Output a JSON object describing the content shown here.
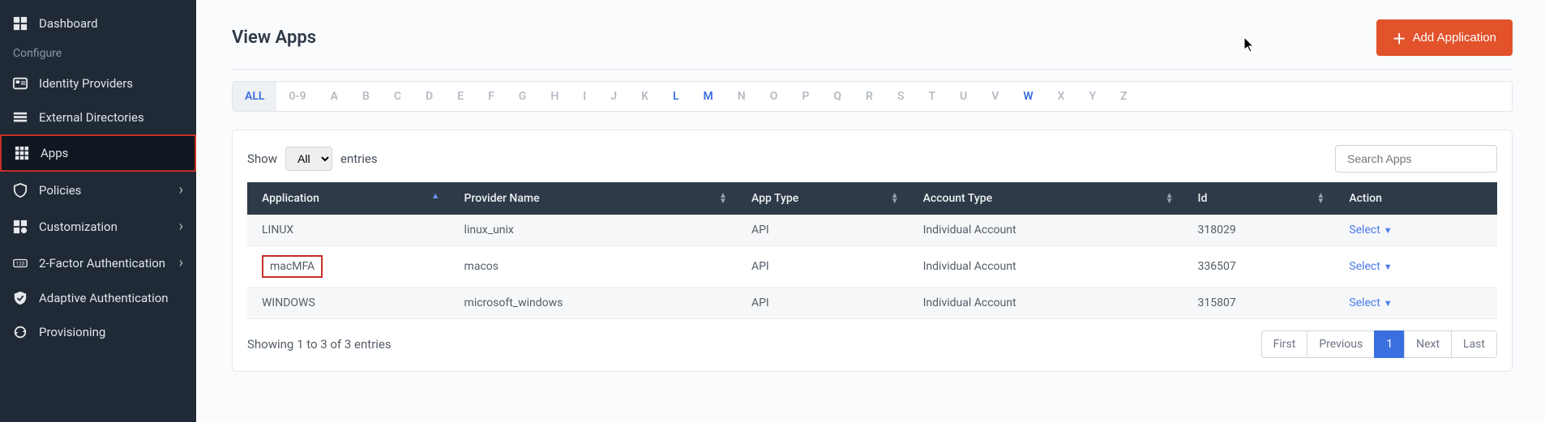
{
  "sidebar": {
    "dashboard": "Dashboard",
    "configure_label": "Configure",
    "items": [
      {
        "label": "Identity Providers",
        "icon": "id"
      },
      {
        "label": "External Directories",
        "icon": "dir"
      },
      {
        "label": "Apps",
        "icon": "grid",
        "active": true
      },
      {
        "label": "Policies",
        "icon": "shield",
        "chev": true
      },
      {
        "label": "Customization",
        "icon": "custom",
        "chev": true
      },
      {
        "label": "2-Factor Authentication",
        "icon": "twofa",
        "chev": true
      },
      {
        "label": "Adaptive Authentication",
        "icon": "adapt"
      },
      {
        "label": "Provisioning",
        "icon": "prov"
      }
    ]
  },
  "header": {
    "title": "View Apps",
    "add_button": "Add Application"
  },
  "alpha": {
    "all": "ALL",
    "items": [
      "0-9",
      "A",
      "B",
      "C",
      "D",
      "E",
      "F",
      "G",
      "H",
      "I",
      "J",
      "K",
      "L",
      "M",
      "N",
      "O",
      "P",
      "Q",
      "R",
      "S",
      "T",
      "U",
      "V",
      "W",
      "X",
      "Y",
      "Z"
    ],
    "highlighted": [
      "L",
      "M",
      "W"
    ]
  },
  "toolbar": {
    "show_label": "Show",
    "entries_label": "entries",
    "show_options": [
      "All"
    ],
    "show_selected": "All",
    "search_placeholder": "Search Apps"
  },
  "table": {
    "headers": [
      "Application",
      "Provider Name",
      "App Type",
      "Account Type",
      "Id",
      "Action"
    ],
    "rows": [
      {
        "application": "LINUX",
        "provider": "linux_unix",
        "apptype": "API",
        "account": "Individual Account",
        "id": "318029",
        "action": "Select",
        "highlight": false
      },
      {
        "application": "macMFA",
        "provider": "macos",
        "apptype": "API",
        "account": "Individual Account",
        "id": "336507",
        "action": "Select",
        "highlight": true
      },
      {
        "application": "WINDOWS",
        "provider": "microsoft_windows",
        "apptype": "API",
        "account": "Individual Account",
        "id": "315807",
        "action": "Select",
        "highlight": false
      }
    ]
  },
  "footer": {
    "info": "Showing 1 to 3 of 3 entries",
    "pager": {
      "first": "First",
      "prev": "Previous",
      "page": "1",
      "next": "Next",
      "last": "Last"
    }
  }
}
